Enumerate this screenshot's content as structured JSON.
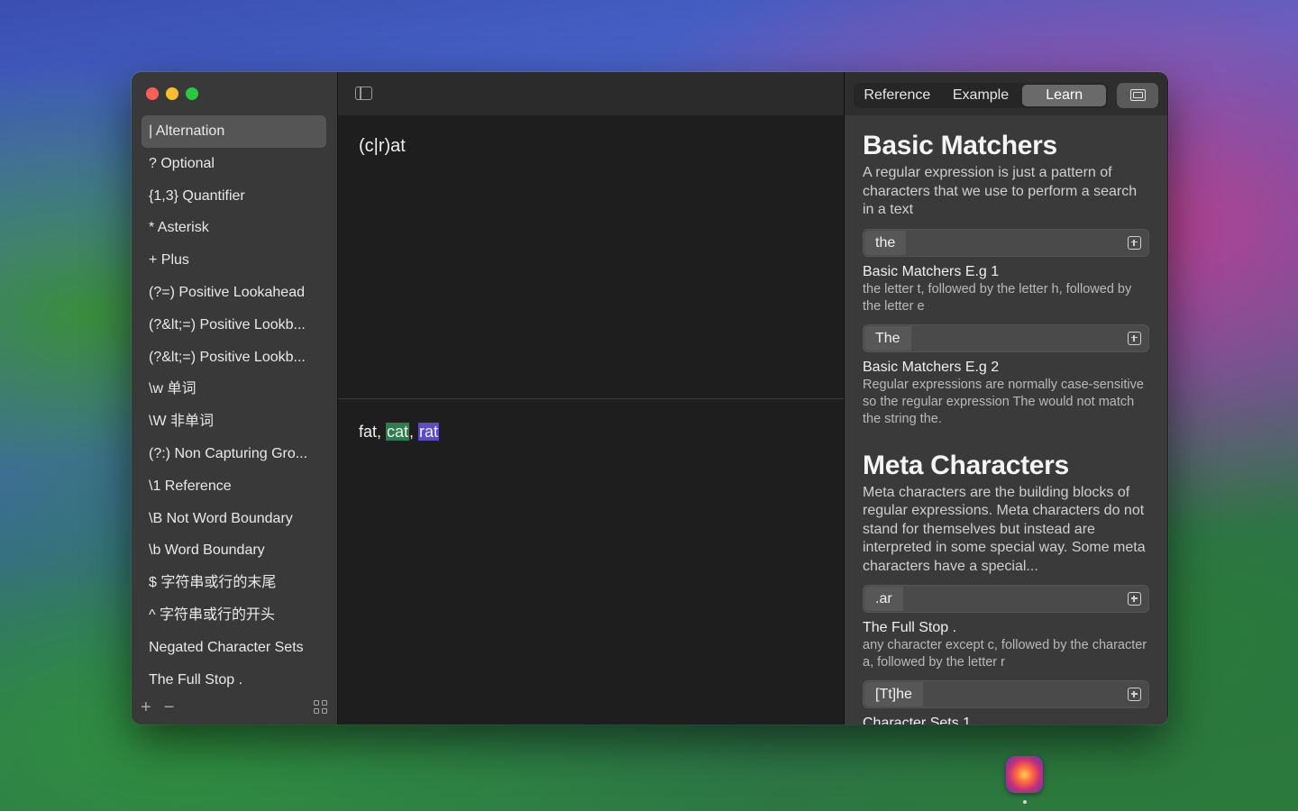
{
  "sidebar": {
    "items": [
      {
        "label": "| Alternation",
        "selected": true
      },
      {
        "label": "? Optional"
      },
      {
        "label": "{1,3} Quantifier"
      },
      {
        "label": "* Asterisk"
      },
      {
        "label": "+ Plus"
      },
      {
        "label": "(?=) Positive Lookahead"
      },
      {
        "label": "(?&lt;=) Positive Lookb..."
      },
      {
        "label": "(?&lt;=) Positive Lookb..."
      },
      {
        "label": "\\w 单词"
      },
      {
        "label": "\\W 非单词"
      },
      {
        "label": "(?:) Non Capturing Gro..."
      },
      {
        "label": "\\1 Reference"
      },
      {
        "label": "\\B Not Word Boundary"
      },
      {
        "label": "\\b Word Boundary"
      },
      {
        "label": "$ 字符串或行的末尾"
      },
      {
        "label": "^ 字符串或行的开头"
      },
      {
        "label": "Negated Character Sets"
      },
      {
        "label": "The Full Stop ."
      }
    ],
    "footer": {
      "add_label": "+",
      "remove_label": "−"
    }
  },
  "editor": {
    "pattern": "(c|r)at",
    "test": {
      "t1": "fat, ",
      "m1": "cat",
      "t2": ", ",
      "m2": "rat"
    }
  },
  "right": {
    "tabs": [
      "Reference",
      "Example",
      "Learn"
    ],
    "active_tab": "Learn",
    "sections": {
      "basic": {
        "title": "Basic Matchers",
        "desc": "A regular expression is just a pattern of characters that we use to perform a search in a text",
        "ex1": {
          "pattern": "the",
          "title": "Basic Matchers E.g 1",
          "desc": "the letter t, followed by the letter h, followed by the letter e"
        },
        "ex2": {
          "pattern": "The",
          "title": "Basic Matchers E.g  2",
          "desc": "Regular expressions are normally case-sensitive so the regular expression The would not match the string the."
        }
      },
      "meta": {
        "title": "Meta Characters",
        "desc": "Meta characters are the building blocks of regular expressions. Meta characters do not stand for themselves but instead are interpreted in some special way. Some meta characters have a special...",
        "ex1": {
          "pattern": ".ar",
          "title": "The Full Stop .",
          "desc": "any character except c, followed by the character a, followed by the letter r"
        },
        "ex2": {
          "pattern": "[Tt]he",
          "title": "Character Sets 1"
        }
      }
    }
  },
  "colors": {
    "match_green": "#2e7d4f",
    "match_purple": "#5b4bc4"
  }
}
